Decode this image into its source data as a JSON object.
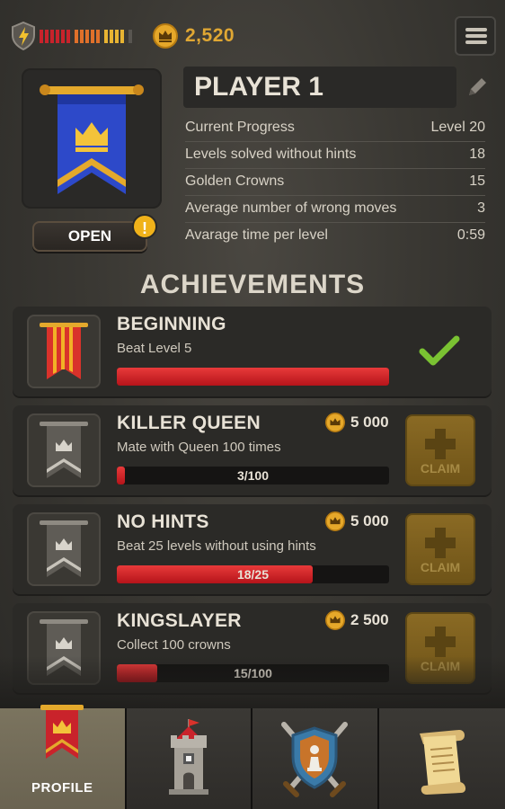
{
  "top_bar": {
    "energy_icon": "lightning-shield-icon",
    "energy_colors": [
      "#c8232b",
      "#e0702a",
      "#e8b432",
      "#585550"
    ],
    "coins": "2,520",
    "coin_icon": "crown-coin-icon",
    "menu_icon": "hamburger-menu-icon"
  },
  "profile": {
    "banner_icon": "blue-crown-banner-icon",
    "open_label": "OPEN",
    "alert_label": "!",
    "player_name": "PLAYER 1",
    "edit_icon": "pencil-icon",
    "stats": [
      {
        "label": "Current Progress",
        "value": "Level 20"
      },
      {
        "label": "Levels solved without hints",
        "value": "18"
      },
      {
        "label": "Golden Crowns",
        "value": "15"
      },
      {
        "label": "Average number of wrong moves",
        "value": "3"
      },
      {
        "label": "Avarage time per level",
        "value": "0:59"
      }
    ]
  },
  "achievements": {
    "title": "ACHIEVEMENTS",
    "claim_label": "CLAIM",
    "items": [
      {
        "name": "BEGINNING",
        "desc": "Beat Level 5",
        "progress": 1.0,
        "progress_label": "",
        "reward": "",
        "status": "completed"
      },
      {
        "name": "KILLER QUEEN",
        "desc": "Mate with Queen 100 times",
        "progress": 0.03,
        "progress_label": "3/100",
        "reward": "5 000",
        "status": "in-progress"
      },
      {
        "name": "NO HINTS",
        "desc": "Beat 25 levels without using hints",
        "progress": 0.72,
        "progress_label": "18/25",
        "reward": "5 000",
        "status": "in-progress"
      },
      {
        "name": "KINGSLAYER",
        "desc": "Collect 100 crowns",
        "progress": 0.15,
        "progress_label": "15/100",
        "reward": "2 500",
        "status": "in-progress"
      }
    ]
  },
  "tabs": [
    {
      "label": "PROFILE",
      "icon": "banner-icon",
      "active": true
    },
    {
      "label": "",
      "icon": "castle-tower-icon",
      "active": false
    },
    {
      "label": "",
      "icon": "shield-swords-icon",
      "active": false
    },
    {
      "label": "",
      "icon": "scroll-icon",
      "active": false
    }
  ],
  "colors": {
    "accent_gold": "#e0a733",
    "progress_red": "#d42a2f",
    "check_green": "#7ac232",
    "background": "#3a3833"
  }
}
